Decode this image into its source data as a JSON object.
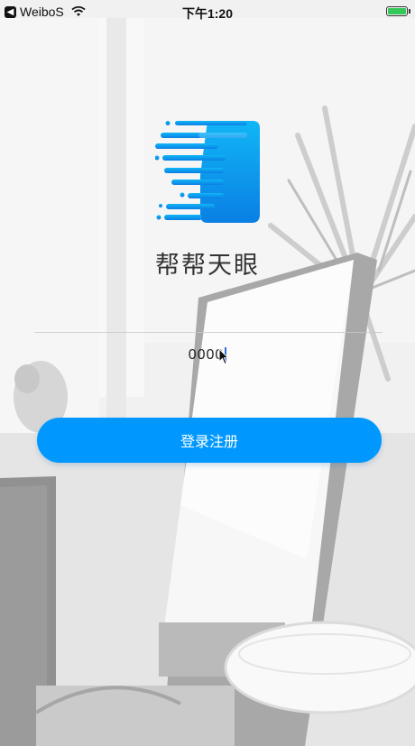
{
  "status_bar": {
    "back_glyph": "◀",
    "back_app": "WeiboS",
    "time": "下午1:20",
    "wifi_icon": "wifi-icon",
    "battery_icon": "battery-icon",
    "battery_level": 1.0,
    "battery_color": "#35c75a"
  },
  "logo_icon": "speed-stripes-logo-icon",
  "app_title": "帮帮天眼",
  "code_field": {
    "value": "0000"
  },
  "login_button": {
    "label": "登录注册",
    "color": "#0098fe"
  }
}
